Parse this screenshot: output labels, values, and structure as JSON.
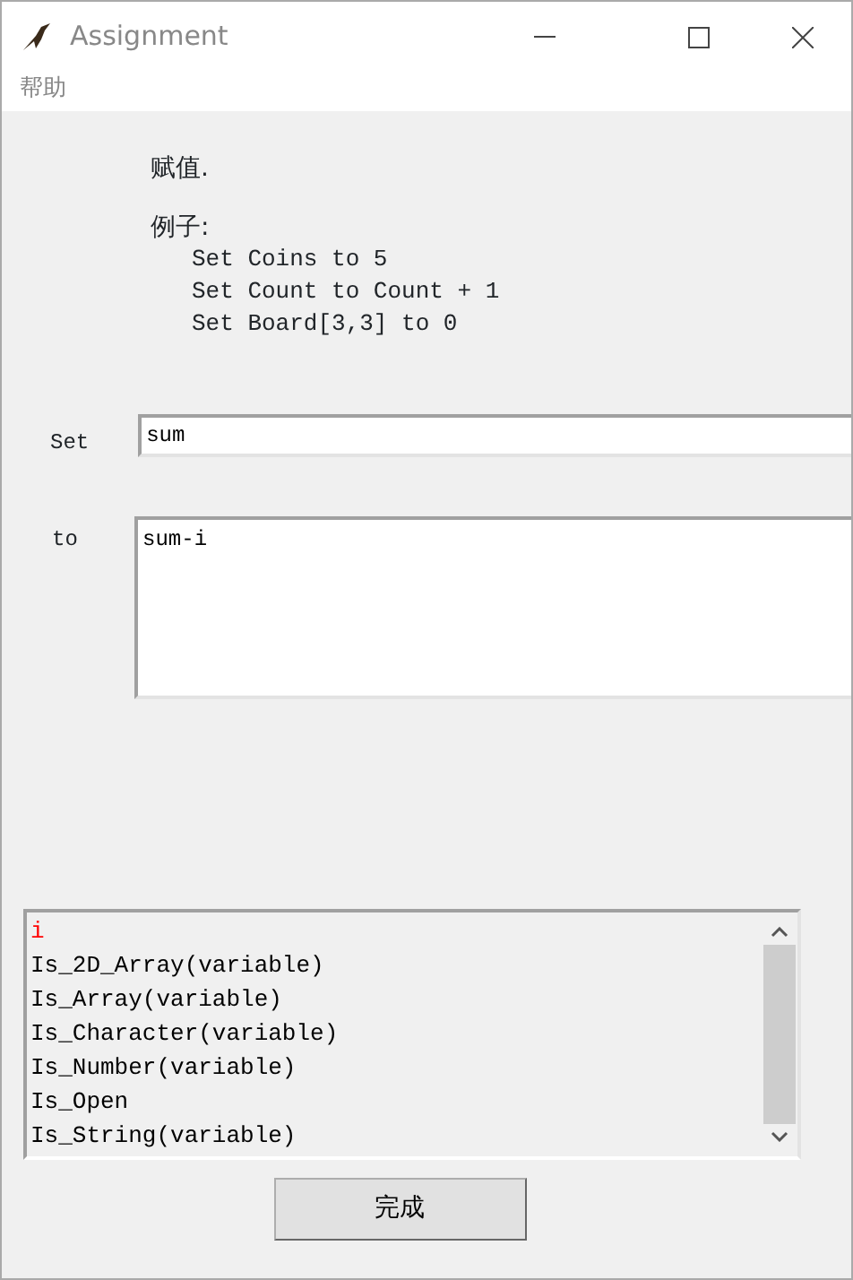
{
  "window": {
    "title": "Assignment"
  },
  "menu": [
    {
      "label": "帮助"
    }
  ],
  "description": "赋值.",
  "examples": {
    "heading": "例子:",
    "lines": [
      "Set Coins to 5",
      "Set Count to Count + 1",
      "Set Board[3,3] to 0"
    ]
  },
  "set_field": {
    "label": "Set",
    "value": "sum"
  },
  "to_field": {
    "label": "to",
    "value": "sum-i"
  },
  "list": [
    {
      "text": "i",
      "color": "#ff0000"
    },
    {
      "text": "Is_2D_Array(variable)",
      "color": "#000000"
    },
    {
      "text": "Is_Array(variable)",
      "color": "#000000"
    },
    {
      "text": "Is_Character(variable)",
      "color": "#000000"
    },
    {
      "text": "Is_Number(variable)",
      "color": "#000000"
    },
    {
      "text": "Is_Open",
      "color": "#000000"
    },
    {
      "text": "Is_String(variable)",
      "color": "#000000"
    }
  ],
  "buttons": [
    {
      "label": "完成"
    }
  ]
}
